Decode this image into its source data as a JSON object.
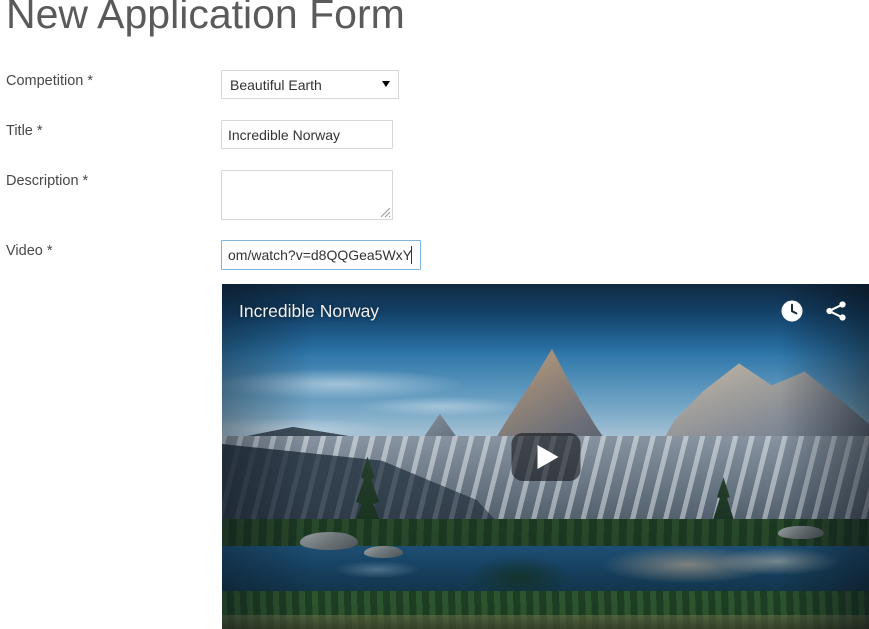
{
  "page": {
    "title": "New Application Form"
  },
  "form": {
    "fields": [
      {
        "label": "Competition *",
        "type": "select",
        "value": "Beautiful Earth",
        "options": [
          "Beautiful Earth"
        ]
      },
      {
        "label": "Title *",
        "type": "text",
        "value": "Incredible Norway",
        "placeholder": ""
      },
      {
        "label": "Description *",
        "type": "textarea",
        "value": "",
        "placeholder": ""
      },
      {
        "label": "Video *",
        "type": "text",
        "value": "om/watch?v=d8QQGea5WxY",
        "placeholder": ""
      }
    ]
  },
  "video_player": {
    "title": "Incredible Norway",
    "watch_later_icon": "clock-icon",
    "share_icon": "share-icon",
    "play_icon": "play-icon"
  },
  "colors": {
    "heading": "#5a5a5a",
    "label": "#484848",
    "input_border": "#d7d7d7",
    "input_border_focus": "#7fb4dd",
    "text": "#333333"
  }
}
